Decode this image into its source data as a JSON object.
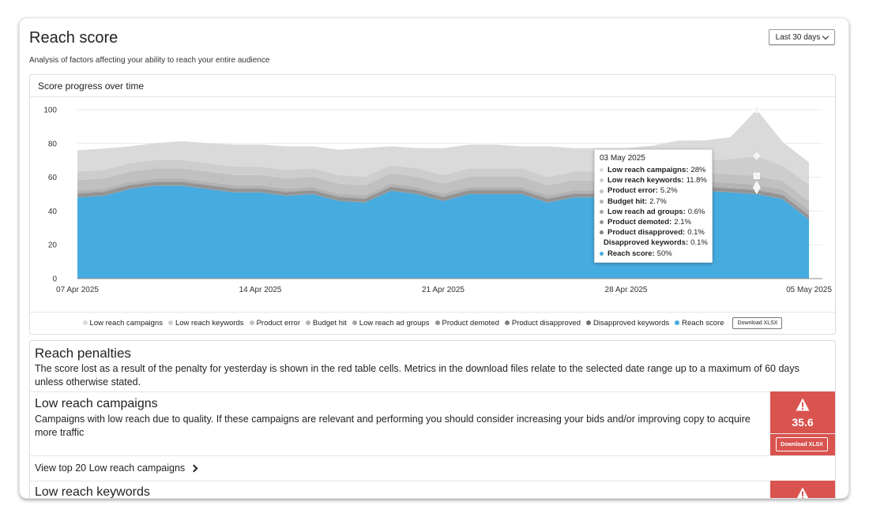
{
  "header": {
    "title": "Reach score",
    "subtitle": "Analysis of factors affecting your ability to reach your entire audience",
    "date_range": "Last 30 days"
  },
  "chart_panel": {
    "title": "Score progress over time",
    "download_label": "Download XLSX"
  },
  "colors": {
    "reach_score": "#46abdf",
    "penalty_red": "#d9534f"
  },
  "chart_data": {
    "type": "area",
    "stacked": true,
    "title": "Score progress over time",
    "ylim": [
      0,
      100
    ],
    "yticks": [
      0,
      20,
      40,
      60,
      80,
      100
    ],
    "xtick_labels": [
      "07 Apr 2025",
      "14 Apr 2025",
      "21 Apr 2025",
      "28 Apr 2025",
      "05 May 2025"
    ],
    "x": [
      "07 Apr 2025",
      "08 Apr 2025",
      "09 Apr 2025",
      "10 Apr 2025",
      "11 Apr 2025",
      "12 Apr 2025",
      "13 Apr 2025",
      "14 Apr 2025",
      "15 Apr 2025",
      "16 Apr 2025",
      "17 Apr 2025",
      "18 Apr 2025",
      "19 Apr 2025",
      "20 Apr 2025",
      "21 Apr 2025",
      "22 Apr 2025",
      "23 Apr 2025",
      "24 Apr 2025",
      "25 Apr 2025",
      "26 Apr 2025",
      "27 Apr 2025",
      "28 Apr 2025",
      "29 Apr 2025",
      "30 Apr 2025",
      "01 May 2025",
      "02 May 2025",
      "03 May 2025",
      "04 May 2025",
      "05 May 2025"
    ],
    "legend_position": "bottom",
    "grid": true,
    "series": [
      {
        "name": "Reach score",
        "color": "#46abdf",
        "values": [
          48,
          49,
          53,
          55,
          55,
          53,
          51,
          51,
          49,
          50,
          46,
          45,
          52,
          50,
          46,
          50,
          50,
          50,
          45,
          48,
          48,
          49,
          50,
          53,
          52,
          51,
          50,
          47,
          35
        ]
      },
      {
        "name": "Disapproved keywords",
        "color": "#6f6f6f",
        "values": [
          0.1,
          0.1,
          0.1,
          0.1,
          0.1,
          0.1,
          0.1,
          0.1,
          0.1,
          0.1,
          0.1,
          0.1,
          0.1,
          0.1,
          0.1,
          0.1,
          0.1,
          0.1,
          0.1,
          0.1,
          0.1,
          0.1,
          0.1,
          0.1,
          0.1,
          0.1,
          0.1,
          0.1,
          0.1
        ]
      },
      {
        "name": "Product disapproved",
        "color": "#808080",
        "values": [
          0.1,
          0.1,
          0.1,
          0.1,
          0.1,
          0.1,
          0.1,
          0.1,
          0.1,
          0.1,
          0.1,
          0.1,
          0.1,
          0.1,
          0.1,
          0.1,
          0.1,
          0.1,
          0.1,
          0.1,
          0.1,
          0.1,
          0.1,
          0.1,
          0.1,
          0.1,
          0.1,
          0.1,
          0.1
        ]
      },
      {
        "name": "Product demoted",
        "color": "#939393",
        "values": [
          2,
          2,
          2,
          2,
          2,
          2,
          2,
          2,
          2,
          2,
          2,
          2,
          2,
          2,
          2,
          2,
          2,
          2,
          2,
          2,
          2,
          2,
          2,
          2,
          2.1,
          2.1,
          2.1,
          2.1,
          2.1
        ]
      },
      {
        "name": "Low reach ad groups",
        "color": "#a4a4a4",
        "values": [
          0.6,
          0.6,
          0.6,
          0.6,
          0.6,
          0.6,
          0.6,
          0.6,
          0.6,
          0.6,
          0.6,
          0.6,
          0.6,
          0.6,
          0.6,
          0.6,
          0.6,
          0.6,
          0.6,
          0.6,
          0.6,
          0.6,
          0.6,
          0.6,
          0.6,
          0.6,
          0.6,
          0.6,
          0.6
        ]
      },
      {
        "name": "Budget hit",
        "color": "#b3b3b3",
        "values": [
          1.5,
          1.5,
          1.5,
          1.5,
          1.5,
          1.5,
          1.5,
          1.5,
          1.5,
          1.5,
          1.5,
          1.5,
          1.5,
          1.5,
          1.5,
          1.5,
          1.5,
          1.5,
          1.5,
          1.5,
          1.5,
          1.5,
          2.7,
          2.7,
          2.7,
          2.7,
          2.7,
          2.7,
          2.7
        ]
      },
      {
        "name": "Product error",
        "color": "#c0c0c0",
        "values": [
          6,
          6,
          6,
          6,
          6,
          6,
          6,
          6,
          6,
          6,
          6,
          6,
          6,
          6,
          6,
          6,
          6,
          6,
          6,
          6,
          6,
          6,
          5.2,
          5.2,
          5.2,
          5.2,
          5.2,
          5.2,
          5.2
        ]
      },
      {
        "name": "Low reach keywords",
        "color": "#cdcdcd",
        "values": [
          5,
          5,
          5,
          5,
          5,
          5,
          5,
          5,
          5,
          5,
          5,
          5,
          5,
          5,
          5,
          5,
          5,
          5,
          5,
          5,
          5,
          5,
          5,
          6,
          7,
          9,
          11.8,
          9,
          10
        ]
      },
      {
        "name": "Low reach campaigns",
        "color": "#dadada",
        "values": [
          12.7,
          12.7,
          10,
          10,
          11,
          12,
          13,
          13,
          14,
          13,
          15,
          17,
          11,
          12,
          16,
          14,
          14,
          13,
          18,
          14,
          14,
          13,
          13,
          12,
          12,
          13,
          28,
          14,
          13
        ]
      }
    ]
  },
  "tooltip": {
    "date": "03 May 2025",
    "rows": [
      {
        "label": "Low reach campaigns:",
        "value": "28%",
        "color": "#dadada"
      },
      {
        "label": "Low reach keywords:",
        "value": "11.8%",
        "color": "#cdcdcd"
      },
      {
        "label": "Product error:",
        "value": "5.2%",
        "color": "#c0c0c0"
      },
      {
        "label": "Budget hit:",
        "value": "2.7%",
        "color": "#b3b3b3"
      },
      {
        "label": "Low reach ad groups:",
        "value": "0.6%",
        "color": "#a4a4a4"
      },
      {
        "label": "Product demoted:",
        "value": "2.1%",
        "color": "#939393"
      },
      {
        "label": "Product disapproved:",
        "value": "0.1%",
        "color": "#808080"
      },
      {
        "label": "Disapproved keywords:",
        "value": "0.1%",
        "color": "#6f6f6f"
      },
      {
        "label": "Reach score:",
        "value": "50%",
        "color": "#46abdf"
      }
    ]
  },
  "penalties": {
    "title": "Reach penalties",
    "description": "The score lost as a result of the penalty for yesterday is shown in the red table cells. Metrics in the download files relate to the selected date range up to a maximum of 60 days unless otherwise stated.",
    "items": [
      {
        "title": "Low reach campaigns",
        "description": "Campaigns with low reach due to quality. If these campaigns are relevant and performing you should consider increasing your bids and/or improving copy to acquire more traffic",
        "value": "35.6",
        "download_label": "Download XLSX",
        "link": "View top 20 Low reach campaigns"
      },
      {
        "title": "Low reach keywords"
      }
    ]
  }
}
